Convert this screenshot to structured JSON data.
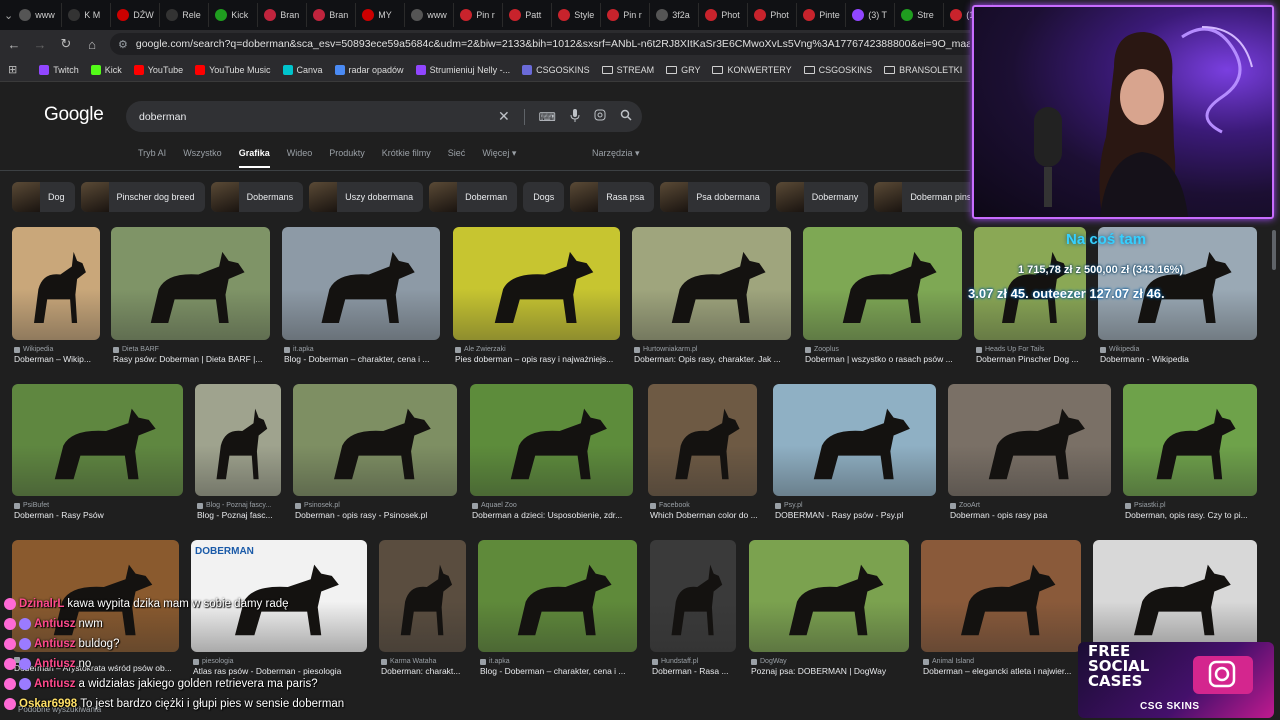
{
  "browser": {
    "tabs": [
      {
        "label": "www",
        "color": "#555"
      },
      {
        "label": "K M",
        "color": "#333"
      },
      {
        "label": "DŹW",
        "color": "#c00"
      },
      {
        "label": "Rele",
        "color": "#333"
      },
      {
        "label": "Kick",
        "color": "#1f9d1f"
      },
      {
        "label": "Bran",
        "color": "#c0243d"
      },
      {
        "label": "Bran",
        "color": "#c0243d"
      },
      {
        "label": "MY",
        "color": "#c00"
      },
      {
        "label": "www",
        "color": "#555"
      },
      {
        "label": "Pin r",
        "color": "#c8232c"
      },
      {
        "label": "Patt",
        "color": "#c8232c"
      },
      {
        "label": "Style",
        "color": "#c8232c"
      },
      {
        "label": "Pin r",
        "color": "#c8232c"
      },
      {
        "label": "3f2a",
        "color": "#555"
      },
      {
        "label": "Phot",
        "color": "#c8232c"
      },
      {
        "label": "Phot",
        "color": "#c8232c"
      },
      {
        "label": "Pinte",
        "color": "#c8232c"
      },
      {
        "label": "(3) T",
        "color": "#9146ff"
      },
      {
        "label": "Stre",
        "color": "#1f9d1f"
      },
      {
        "label": "(1",
        "color": "#c8232c"
      }
    ],
    "url": "google.com/search?q=doberman&sca_esv=50893ece59a5684c&udm=2&biw=2133&bih=1012&sxsrf=ANbL-n6t2RJ8XItKaSr3E6CMwoXvLs5Vng%3A1776742388800&ei=9O_maaTFMNipxc8P6uWByAk&ve",
    "bookmarks": [
      {
        "label": "Twitch",
        "color": "#9146ff",
        "folder": false
      },
      {
        "label": "Kick",
        "color": "#53fc18",
        "folder": false
      },
      {
        "label": "YouTube",
        "color": "#ff0000",
        "folder": false
      },
      {
        "label": "YouTube Music",
        "color": "#ff0000",
        "folder": false
      },
      {
        "label": "Canva",
        "color": "#00c4cc",
        "folder": false
      },
      {
        "label": "radar opadów",
        "color": "#4a8af4",
        "folder": false
      },
      {
        "label": "Strumieniuj Nelly -...",
        "color": "#9146ff",
        "folder": false
      },
      {
        "label": "CSGOSKINS",
        "color": "#6a6ad8",
        "folder": false
      },
      {
        "label": "STREAM",
        "color": "",
        "folder": true
      },
      {
        "label": "GRY",
        "color": "",
        "folder": true
      },
      {
        "label": "KONWERTERY",
        "color": "",
        "folder": true
      },
      {
        "label": "CSGOSKINS",
        "color": "",
        "folder": true
      },
      {
        "label": "BRANSOLETKI",
        "color": "",
        "folder": true
      },
      {
        "label": "Ustawienia strumien...",
        "color": "#c00",
        "folder": false
      }
    ]
  },
  "google": {
    "logo": "Google",
    "query": "doberman",
    "tabs": [
      "Tryb AI",
      "Wszystko",
      "Grafika",
      "Wideo",
      "Produkty",
      "Krótkie filmy",
      "Sieć",
      "Więcej ▾"
    ],
    "active_tab": "Grafika",
    "tools": "Narzędzia ▾",
    "chips": [
      {
        "label": "Dog",
        "thumb": true
      },
      {
        "label": "Pinscher dog breed",
        "thumb": true
      },
      {
        "label": "Dobermans",
        "thumb": true
      },
      {
        "label": "Uszy dobermana",
        "thumb": true
      },
      {
        "label": "Doberman",
        "thumb": true
      },
      {
        "label": "Dogs",
        "thumb": false
      },
      {
        "label": "Rasa psa",
        "thumb": true
      },
      {
        "label": "Psa dobermana",
        "thumb": true
      },
      {
        "label": "Dobermany",
        "thumb": true
      },
      {
        "label": "Doberman pinscher",
        "thumb": true
      }
    ],
    "results": [
      {
        "source": "Wikipedia",
        "title": "Doberman – Wikip...",
        "bg": "#c9a77a"
      },
      {
        "source": "Dieta BARF",
        "title": "Rasy psów: Doberman | Dieta BARF |...",
        "bg": "#7f9467"
      },
      {
        "source": "it.apka",
        "title": "Blog - Doberman – charakter, cena i ...",
        "bg": "#8d9aa6"
      },
      {
        "source": "Ale Zwierzaki",
        "title": "Pies doberman – opis rasy i najważniejs...",
        "bg": "#c7c530"
      },
      {
        "source": "Hurtowniakarm.pl",
        "title": "Doberman: Opis rasy, charakter. Jak ...",
        "bg": "#9fa57d"
      },
      {
        "source": "Zooplus",
        "title": "Doberman | wszystko o rasach psów ...",
        "bg": "#7ea854"
      },
      {
        "source": "Heads Up For Tails",
        "title": "Doberman Pinscher Dog ...",
        "bg": "#8aa855"
      },
      {
        "source": "Wikipedia",
        "title": "Dobermann - Wikipedia",
        "bg": "#9aa9b5"
      },
      {
        "source": "PsiBufet",
        "title": "Doberman - Rasy Psów",
        "bg": "#5f8740"
      },
      {
        "source": "Blog - Poznaj fascy...",
        "title": "Blog - Poznaj fasc...",
        "bg": "#9fa38e"
      },
      {
        "source": "Psinosek.pl",
        "title": "Doberman - opis rasy - Psinosek.pl",
        "bg": "#7e8f63"
      },
      {
        "source": "Aquael Zoo",
        "title": "Doberman a dzieci: Usposobienie, zdr...",
        "bg": "#5d8c3b"
      },
      {
        "source": "Facebook",
        "title": "Which Doberman color do ...",
        "bg": "#6e5a44"
      },
      {
        "source": "Psy.pl",
        "title": "DOBERMAN - Rasy psów - Psy.pl",
        "bg": "#8fb0c4"
      },
      {
        "source": "ZooArt",
        "title": "Doberman - opis rasy psa",
        "bg": "#7a7066"
      },
      {
        "source": "Psiastki.pl",
        "title": "Doberman, opis rasy. Czy to pi...",
        "bg": "#6ea24a"
      },
      {
        "source": "",
        "title": "Doberman – Arystokrata wśród psów ob...",
        "bg": "#8a5a2e"
      },
      {
        "source": "piesologia",
        "title": "Atlas ras psów - Doberman - piesologia",
        "bg": "#f2f2f2"
      },
      {
        "source": "Karma Wataha",
        "title": "Doberman: charakt...",
        "bg": "#5a4d3f"
      },
      {
        "source": "it.apka",
        "title": "Blog - Doberman – charakter, cena i ...",
        "bg": "#5f8a3a"
      },
      {
        "source": "Hundstaff.pl",
        "title": "Doberman - Rasa ...",
        "bg": "#3a3a3a"
      },
      {
        "source": "DogWay",
        "title": "Poznaj psa: DOBERMAN | DogWay",
        "bg": "#7ba24f"
      },
      {
        "source": "Animal Island",
        "title": "Doberman – elegancki atleta i najwier...",
        "bg": "#8a5a3a"
      },
      {
        "source": "",
        "title": "",
        "bg": "#d8d8d8"
      }
    ],
    "doberman_card": "DOBERMAN",
    "related": "Podobne wyszukiwania"
  },
  "overlay": {
    "title": "Na coś tam",
    "stats": "1 715,78 zł z 500,00 zł (343.16%)",
    "ticker": "3.07 zł   45. outeezer   127.07 zł   46."
  },
  "chat": [
    {
      "name": "DzinalrL",
      "msg": "kawa wypita dzika mam w sobie damy radę",
      "badges": 1
    },
    {
      "name": "Antiusz",
      "msg": "nwm",
      "badges": 2
    },
    {
      "name": "Antiusz",
      "msg": "buldog?",
      "badges": 2
    },
    {
      "name": "Antiusz",
      "msg": "no",
      "badges": 2
    },
    {
      "name": "Antiusz",
      "msg": "a widziałas jakiego golden retrievera ma paris?",
      "badges": 2
    },
    {
      "name": "Oskar6998",
      "msg": "To jest bardzo ciężki i głupi pies w sensie doberman",
      "badges": 1
    }
  ],
  "promo": {
    "line1": "FREE",
    "line2": "SOCIAL",
    "line3": "CASES",
    "brand": "CSG SKINS"
  }
}
